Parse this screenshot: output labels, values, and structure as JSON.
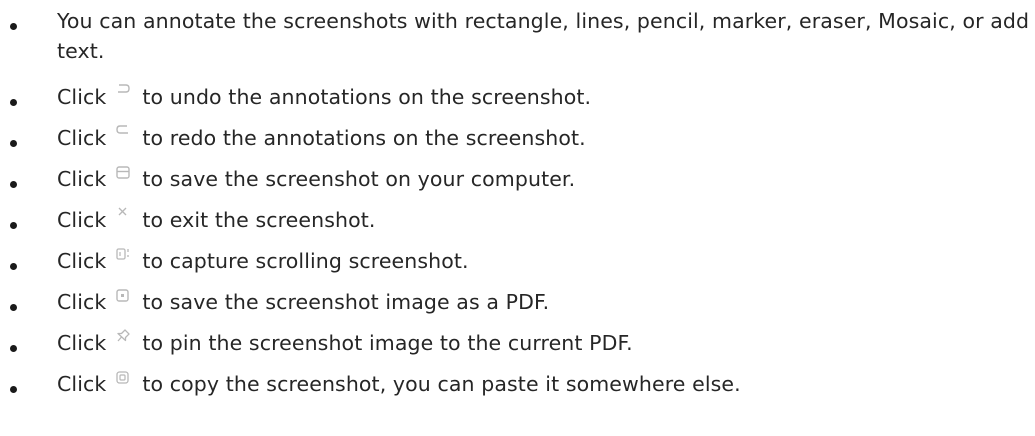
{
  "bullets": {
    "intro": "You can annotate the screenshots with rectangle, lines, pencil, marker, eraser, Mosaic, or add text.",
    "click_word": "Click",
    "undo": {
      "icon": "undo-icon",
      "text": "to undo the annotations on the screenshot."
    },
    "redo": {
      "icon": "redo-icon",
      "text": "to redo the annotations on the screenshot."
    },
    "save": {
      "icon": "save-icon",
      "text": "to save the screenshot on your computer."
    },
    "exit": {
      "icon": "close-icon",
      "text": "to exit the screenshot."
    },
    "scroll": {
      "icon": "scrolling-screenshot-icon",
      "text": "to capture scrolling screenshot."
    },
    "pdf": {
      "icon": "save-as-pdf-icon",
      "text": "to save the screenshot image as a PDF."
    },
    "pin": {
      "icon": "pin-icon",
      "text": "to pin the screenshot image to the current PDF."
    },
    "copy": {
      "icon": "copy-icon",
      "text": "to copy the screenshot, you can paste it somewhere else."
    }
  },
  "colors": {
    "text": "#262626",
    "icon_stroke": "#b8b8b8"
  }
}
